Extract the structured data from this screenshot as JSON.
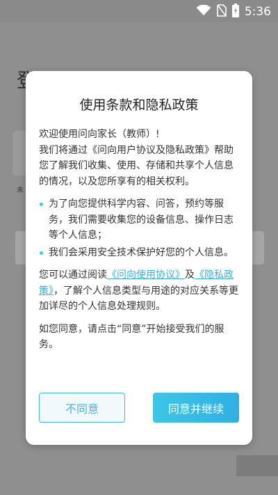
{
  "status_bar": {
    "time": "5:36",
    "icons": [
      "wifi-icon",
      "no-sim-icon",
      "battery-charging-icon"
    ]
  },
  "background": {
    "title": "登录",
    "small_text": "未"
  },
  "dialog": {
    "title": "使用条款和隐私政策",
    "greeting": "欢迎使用问向家长（教师）!",
    "intro": "我们将通过《问向用户协议及隐私政策》帮助您了解我们收集、使用、存储和共享个人信息的情况，以及您所享有的相关权利。",
    "bullets": [
      "为了向您提供科学内容、问答，预约等服务，我们需要收集您的设备信息、操作日志等个人信息；",
      "我们会采用安全技术保护好您的个人信息。"
    ],
    "read_prefix": "您可以通过阅读",
    "link_usage": "《问向使用协议》",
    "read_and": "及",
    "link_privacy": "《隐私政策》",
    "read_suffix": "，了解个人信息类型与用途的对应关系等更加详尽的个人信息处理规则。",
    "consent": "如您同意，请点击“同意”开始接受我们的服务。",
    "disagree_label": "不同意",
    "agree_label": "同意并继续"
  },
  "colors": {
    "accent": "#3cc6e6",
    "overlay": "#8c8c8c"
  }
}
